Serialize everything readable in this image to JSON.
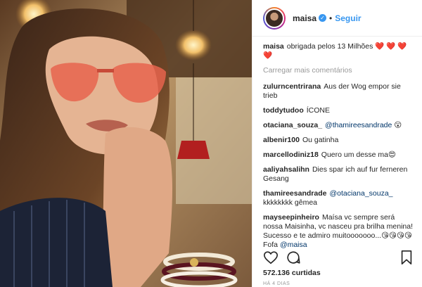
{
  "header": {
    "username": "maisa",
    "verified_mark": "✓",
    "dot": "•",
    "follow_label": "Seguir"
  },
  "caption": {
    "username": "maisa",
    "text": "obrigada pelos 13 Milhões",
    "hearts": "❤️ ❤️ ❤️ ❤️"
  },
  "load_more_label": "Carregar mais comentários",
  "comments": [
    {
      "user": "zulurncentrirana",
      "text": "Aus der Wog empor sie trieb"
    },
    {
      "user": "toddytudoo",
      "text": "ÍCONE"
    },
    {
      "user": "otaciana_souza_",
      "mention": "@thamireesandrade",
      "text": "😮"
    },
    {
      "user": "albenir100",
      "text": "Ou gatinha"
    },
    {
      "user": "marcellodiniz18",
      "text": "Quero um desse ma😍"
    },
    {
      "user": "aaliyahsalihn",
      "text": "Dies spar ich auf fur ferneren Gesang"
    },
    {
      "user": "thamireesandrade",
      "mention": "@otaciana_souza_",
      "text": "kkkkkkkk gêmea"
    },
    {
      "user": "mayseepinheiro",
      "text": "Maísa vc sempre será nossa Maisinha, vc nasceu pra brilha menina! Sucesso e te admiro muitooooooo...😘😘😘😘 Fofa",
      "mention": "@maisa"
    }
  ],
  "likes": "572.136 curtidas",
  "time": "HÁ 4 DIAS",
  "icons": [
    "heart-icon",
    "comment-icon",
    "bookmark-icon",
    "verified-icon"
  ],
  "colors": {
    "link": "#3897f0",
    "mention": "#003569",
    "heart": "#d0021b"
  }
}
